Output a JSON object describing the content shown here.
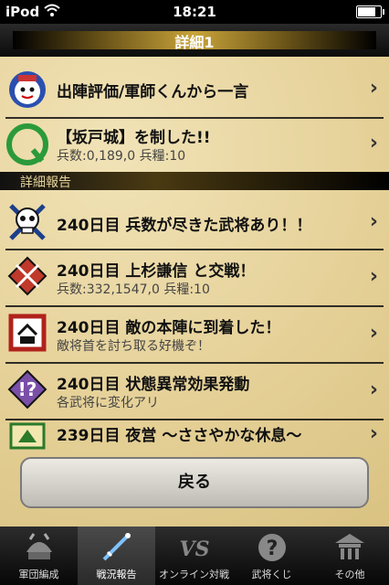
{
  "status": {
    "carrier": "iPod",
    "time": "18:21",
    "battery_level": 0.85
  },
  "header": {
    "title": "詳細1"
  },
  "top_rows": [
    {
      "icon": "advisor-face-icon",
      "line1": "出陣評価/軍師くんから一言",
      "line2": ""
    },
    {
      "icon": "green-q-seal-icon",
      "line1": "【坂戸城】を制した!!",
      "line2": "兵数:0,189,0 兵糧:10"
    }
  ],
  "section": {
    "title": "詳細報告"
  },
  "reports": [
    {
      "icon": "skull-icon",
      "line1": "240日目 兵数が尽きた武将あり！！",
      "line2": ""
    },
    {
      "icon": "crossed-swords-icon",
      "line1": "240日目 上杉謙信 と交戦！",
      "line2": "兵数:332,1547,0 兵糧:10"
    },
    {
      "icon": "camp-banner-icon",
      "line1": "240日目 敵の本陣に到着した！",
      "line2": "敵将首を討ち取る好機ぞ！"
    },
    {
      "icon": "status-alert-icon",
      "line1": "240日目 状態異常効果発動",
      "line2": "各武将に変化アリ"
    },
    {
      "icon": "night-camp-icon",
      "line1": "239日目 夜営 〜ささやかな休息〜",
      "line2": ""
    }
  ],
  "back_button": {
    "label": "戻る"
  },
  "tabs": [
    {
      "label": "軍団編成",
      "icon": "samurai-helmet-icon",
      "active": false
    },
    {
      "label": "戦況報告",
      "icon": "battle-sword-icon",
      "active": true
    },
    {
      "label": "オンライン対戦",
      "icon": "vs-icon",
      "active": false
    },
    {
      "label": "武将くじ",
      "icon": "question-mark-icon",
      "active": false
    },
    {
      "label": "その他",
      "icon": "temple-icon",
      "active": false
    }
  ]
}
